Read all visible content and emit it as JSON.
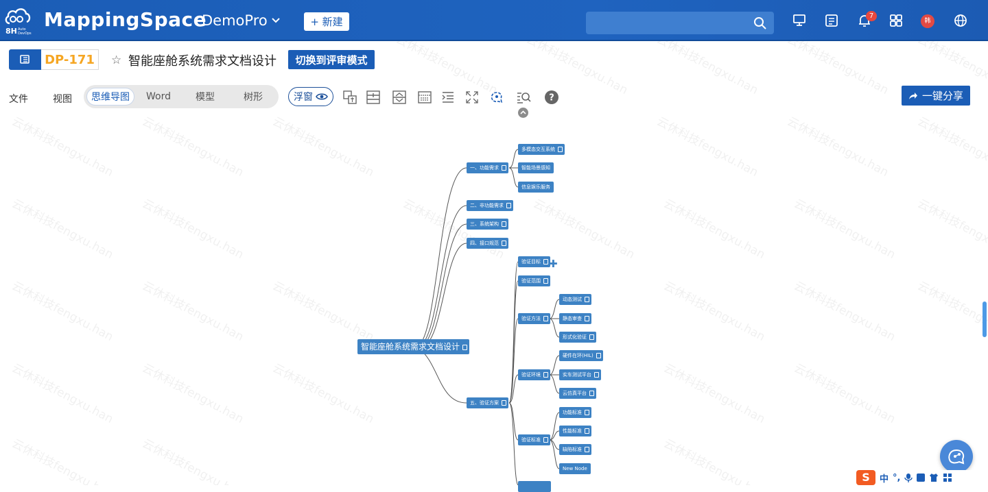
{
  "header": {
    "logo_text": "8H",
    "logo_sub": "Auto DevOps",
    "brand": "MappingSpace",
    "project": "DemoPro",
    "new_button": "+ 新建",
    "search_placeholder": "",
    "notification_count": "7",
    "avatar_text": "韩"
  },
  "document": {
    "id": "DP-171",
    "title": "智能座舱系统需求文档设计",
    "switch_button": "切换到评审模式"
  },
  "menu": {
    "file": "文件",
    "view": "视图",
    "views": [
      "思维导图",
      "Word",
      "模型",
      "树形"
    ],
    "active_view": "思维导图",
    "float_window": "浮窗",
    "share_button": "一键分享"
  },
  "watermark": "云休科技fengxu.han",
  "mindmap": {
    "root": "智能座舱系统需求文档设计",
    "nodes": {
      "n1": "一、功能需求",
      "n1a": "多模态交互系统",
      "n1b": "智能场景感知",
      "n1c": "信息娱乐服务",
      "n2": "二、非功能需求",
      "n3": "三、系统架构",
      "n4": "四、接口规范",
      "n5": "五、验证方案",
      "v1": "验证目标",
      "v2": "验证范围",
      "v3": "验证方法",
      "v3a": "动态测试",
      "v3b": "静态审查",
      "v3c": "形式化验证",
      "v4": "验证环境",
      "v4a": "硬件在环(HIL)",
      "v4b": "实车测试平台",
      "v4c": "云仿真平台",
      "v5": "验证标准",
      "v5a": "功能标准",
      "v5b": "性能标准",
      "v5c": "缺陷标准",
      "v5d": "New Node"
    }
  },
  "ime": {
    "mode": "中",
    "punct": "°,"
  },
  "colors": {
    "header_bg": "#1b5db6",
    "node_bg": "#3d82c4",
    "doc_id": "#f5a623",
    "badge": "#e8483e"
  }
}
